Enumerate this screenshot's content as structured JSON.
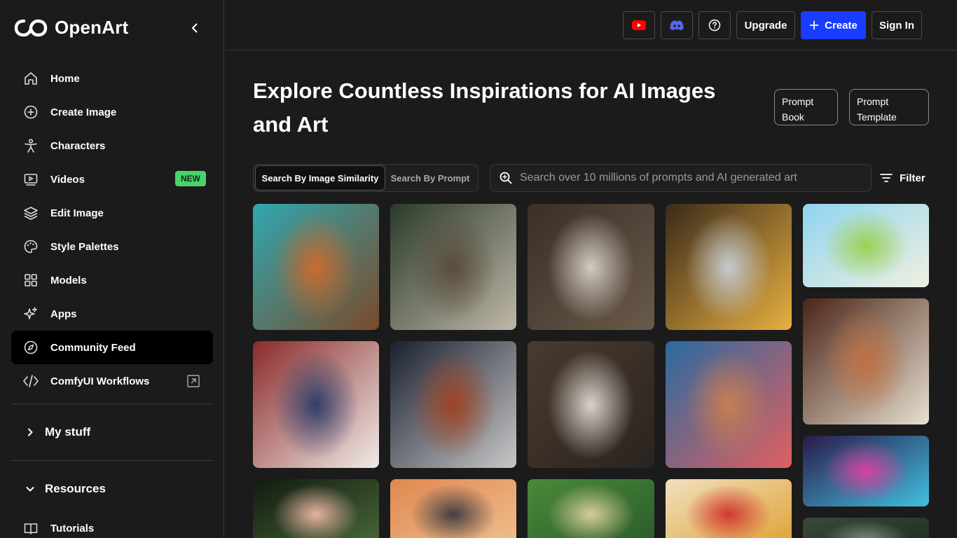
{
  "brand": {
    "name": "OpenArt"
  },
  "sidebar": {
    "items": [
      {
        "label": "Home",
        "icon": "home-icon"
      },
      {
        "label": "Create Image",
        "icon": "plus-circle-icon"
      },
      {
        "label": "Characters",
        "icon": "person-icon"
      },
      {
        "label": "Videos",
        "icon": "video-icon",
        "badge": "NEW"
      },
      {
        "label": "Edit Image",
        "icon": "layers-icon"
      },
      {
        "label": "Style Palettes",
        "icon": "palette-icon"
      },
      {
        "label": "Models",
        "icon": "grid-icon"
      },
      {
        "label": "Apps",
        "icon": "sparkle-icon"
      },
      {
        "label": "Community Feed",
        "icon": "compass-icon",
        "active": true
      },
      {
        "label": "ComfyUI Workflows",
        "icon": "code-icon"
      }
    ],
    "sections": [
      {
        "label": "My stuff",
        "expanded": false
      },
      {
        "label": "Resources",
        "expanded": true
      }
    ],
    "resources": [
      {
        "label": "Tutorials",
        "icon": "book-icon"
      }
    ]
  },
  "topbar": {
    "upgrade_label": "Upgrade",
    "create_label": "Create",
    "signin_label": "Sign In",
    "accent": "#1a3cff"
  },
  "main": {
    "headline": "Explore Countless Inspirations for AI Images and Art",
    "prompt_book_label": "Prompt Book",
    "prompt_template_label": "Prompt Template",
    "search_tabs": [
      {
        "label": "Search By Image Similarity",
        "selected": true
      },
      {
        "label": "Search By Prompt",
        "selected": false
      }
    ],
    "search_placeholder": "Search over 10 millions of prompts and AI generated art",
    "filter_label": "Filter"
  },
  "gallery": [
    {
      "name": "woman-teal-dress-roses-image",
      "palette": [
        "#2fa8b0",
        "#d06a2a",
        "#7a4a2a"
      ]
    },
    {
      "name": "royal-couple-crowns-image",
      "palette": [
        "#2a3a2a",
        "#5a4a3a",
        "#c0b8a8"
      ]
    },
    {
      "name": "woman-white-gown-image",
      "palette": [
        "#3a2e26",
        "#d8d2c8",
        "#6a5a4a"
      ]
    },
    {
      "name": "robot-warrior-image",
      "palette": [
        "#3a2a1a",
        "#c8d0d8",
        "#e8b040"
      ]
    },
    {
      "name": "sunny-meadow-image",
      "palette": [
        "#8fd4f0",
        "#9ad04a",
        "#f0f0e0"
      ]
    },
    {
      "name": "eagle-american-flag-image",
      "palette": [
        "#8a2a2a",
        "#2a3a6a",
        "#f0ece8"
      ]
    },
    {
      "name": "space-telescope-planet-image",
      "palette": [
        "#1a2030",
        "#a04020",
        "#c8c8c8"
      ]
    },
    {
      "name": "woman-ball-gown-room-image",
      "palette": [
        "#4a3a2e",
        "#e0dcd4",
        "#2a2420"
      ]
    },
    {
      "name": "woman-flower-crown-image",
      "palette": [
        "#2a6aa0",
        "#c88050",
        "#e06060"
      ]
    },
    {
      "name": "woman-old-shop-image",
      "palette": [
        "#4a2418",
        "#c07040",
        "#e8e0d0"
      ]
    },
    {
      "name": "man-running-neon-image",
      "palette": [
        "#2a1a4a",
        "#e040a0",
        "#40c0e0"
      ]
    },
    {
      "name": "roses-pattern-image",
      "palette": [
        "#111a10",
        "#f0b8a8",
        "#4a6a3a"
      ]
    },
    {
      "name": "godzilla-sunset-image",
      "palette": [
        "#e08850",
        "#3a3a40",
        "#f0c090"
      ]
    },
    {
      "name": "elf-forest-image",
      "palette": [
        "#4a8a3a",
        "#e0d0a0",
        "#2a5a2a"
      ]
    },
    {
      "name": "bear-red-hat-image",
      "palette": [
        "#f0e0c0",
        "#d0302a",
        "#e0a030"
      ]
    },
    {
      "name": "gray-creature-image",
      "palette": [
        "#3a4a3a",
        "#7a8a7a",
        "#1a2a1a"
      ]
    }
  ]
}
